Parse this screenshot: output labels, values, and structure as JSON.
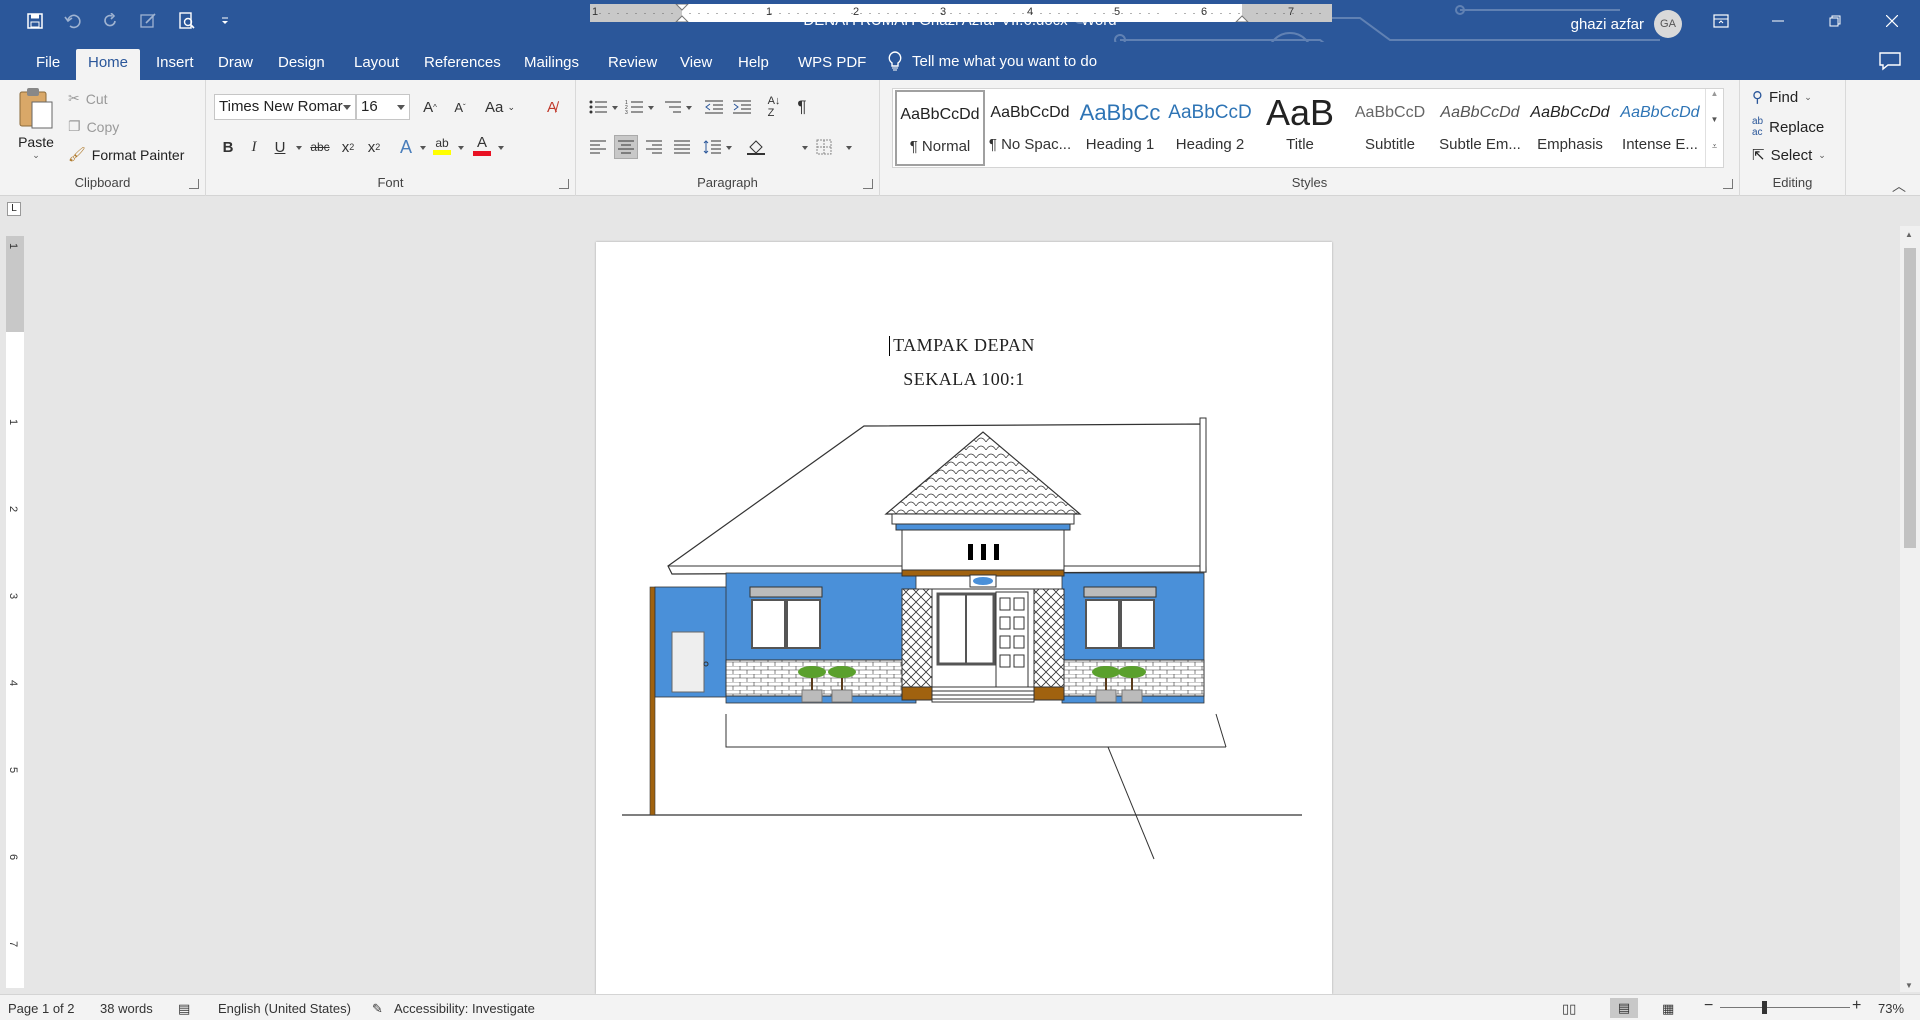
{
  "window": {
    "doc_title": "DENAH RUMAH Ghazi Azfar VII.6.docx  -  Word",
    "user_name": "ghazi azfar",
    "user_initials": "GA"
  },
  "tabs": [
    "File",
    "Home",
    "Insert",
    "Draw",
    "Design",
    "Layout",
    "References",
    "Mailings",
    "Review",
    "View",
    "Help",
    "WPS PDF"
  ],
  "active_tab": "Home",
  "tell_me": "Tell me what you want to do",
  "ribbon": {
    "clipboard": {
      "paste": "Paste",
      "cut": "Cut",
      "copy": "Copy",
      "format_painter": "Format Painter",
      "label": "Clipboard"
    },
    "font": {
      "name": "Times New Romar",
      "size": "16",
      "label": "Font",
      "change_case": "Aa",
      "highlight_color": "#ffff00",
      "font_color": "#e81123"
    },
    "paragraph": {
      "label": "Paragraph"
    },
    "styles": {
      "label": "Styles",
      "items": [
        {
          "preview": "AaBbCcDd",
          "name": "¶ Normal"
        },
        {
          "preview": "AaBbCcDd",
          "name": "¶ No Spac..."
        },
        {
          "preview": "AaBbCc",
          "name": "Heading 1"
        },
        {
          "preview": "AaBbCcD",
          "name": "Heading 2"
        },
        {
          "preview": "AaB",
          "name": "Title"
        },
        {
          "preview": "AaBbCcD",
          "name": "Subtitle"
        },
        {
          "preview": "AaBbCcDd",
          "name": "Subtle Em..."
        },
        {
          "preview": "AaBbCcDd",
          "name": "Emphasis"
        },
        {
          "preview": "AaBbCcDd",
          "name": "Intense E..."
        }
      ]
    },
    "editing": {
      "find": "Find",
      "replace": "Replace",
      "select": "Select",
      "label": "Editing"
    }
  },
  "ruler": {
    "h_numbers": [
      "1",
      "1",
      "2",
      "3",
      "4",
      "5",
      "6",
      "7"
    ],
    "v_numbers": [
      "1",
      "1",
      "2",
      "3",
      "4",
      "5",
      "6",
      "7"
    ]
  },
  "document": {
    "line1": "TAMPAK DEPAN",
    "line2": "SEKALA 100:1"
  },
  "status": {
    "page": "Page 1 of 2",
    "words": "38 words",
    "language": "English (United States)",
    "accessibility": "Accessibility: Investigate",
    "zoom": "73%"
  },
  "colors": {
    "title_bar": "#2b579a",
    "wall_blue": "#4a90d9",
    "brown": "#a0620f",
    "plant_green": "#5aa02c"
  }
}
